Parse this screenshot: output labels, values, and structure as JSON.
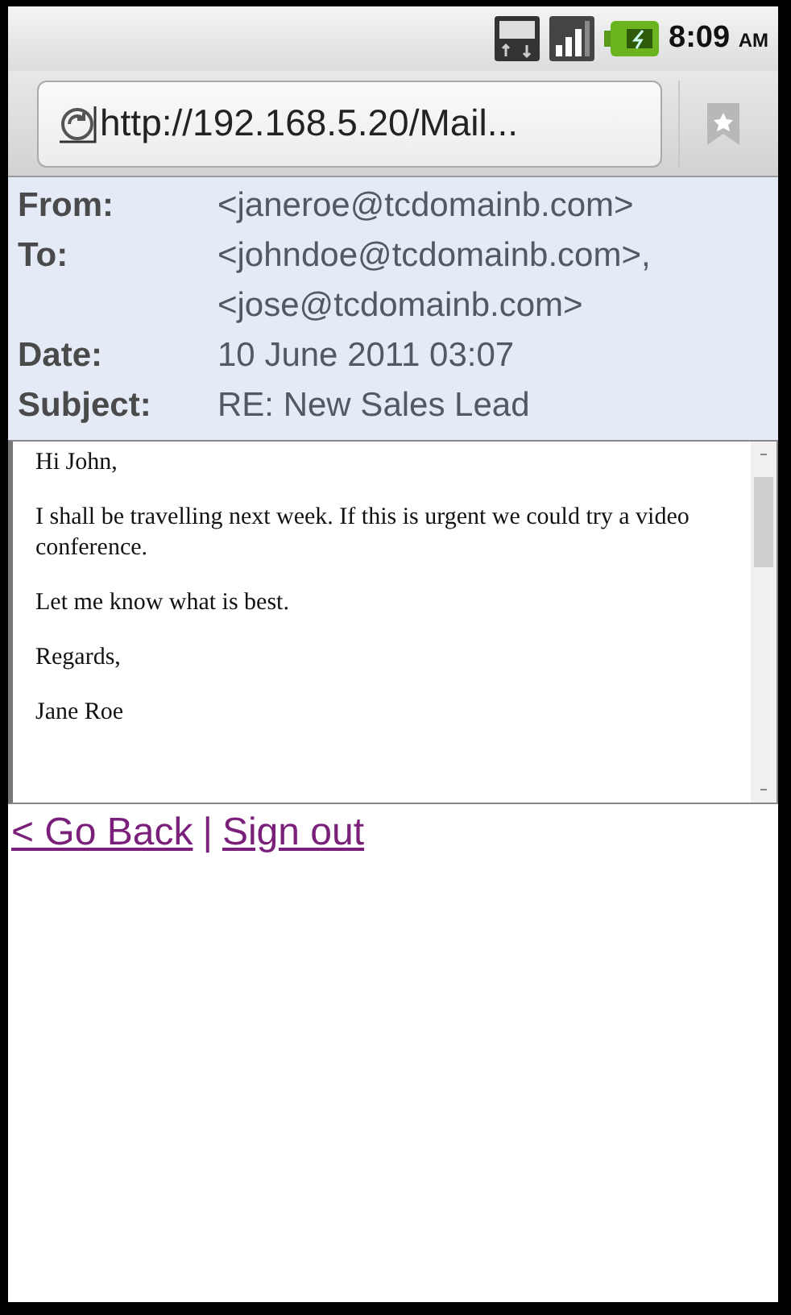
{
  "status_bar": {
    "time": "8:09",
    "meridiem": "AM"
  },
  "address_bar": {
    "url": "http://192.168.5.20/Mail..."
  },
  "header": [
    {
      "label": "From:",
      "values": [
        "<janeroe@tcdomainb.com>"
      ]
    },
    {
      "label": "To:",
      "values": [
        "<johndoe@tcdomainb.com>,",
        "<jose@tcdomainb.com>"
      ]
    },
    {
      "label": "Date:",
      "values": [
        "10 June 2011 03:07"
      ]
    },
    {
      "label": "Subject:",
      "values": [
        "RE: New Sales Lead"
      ]
    }
  ],
  "body": [
    "Hi John,",
    "I shall be travelling next week. If this is urgent we could try a video conference.",
    "Let me know what is best.",
    "Regards,",
    "Jane Roe"
  ],
  "links": [
    {
      "kind": "link",
      "text": "< Go Back"
    },
    {
      "kind": "separator",
      "text": "|"
    },
    {
      "kind": "link",
      "text": "Sign out"
    }
  ]
}
